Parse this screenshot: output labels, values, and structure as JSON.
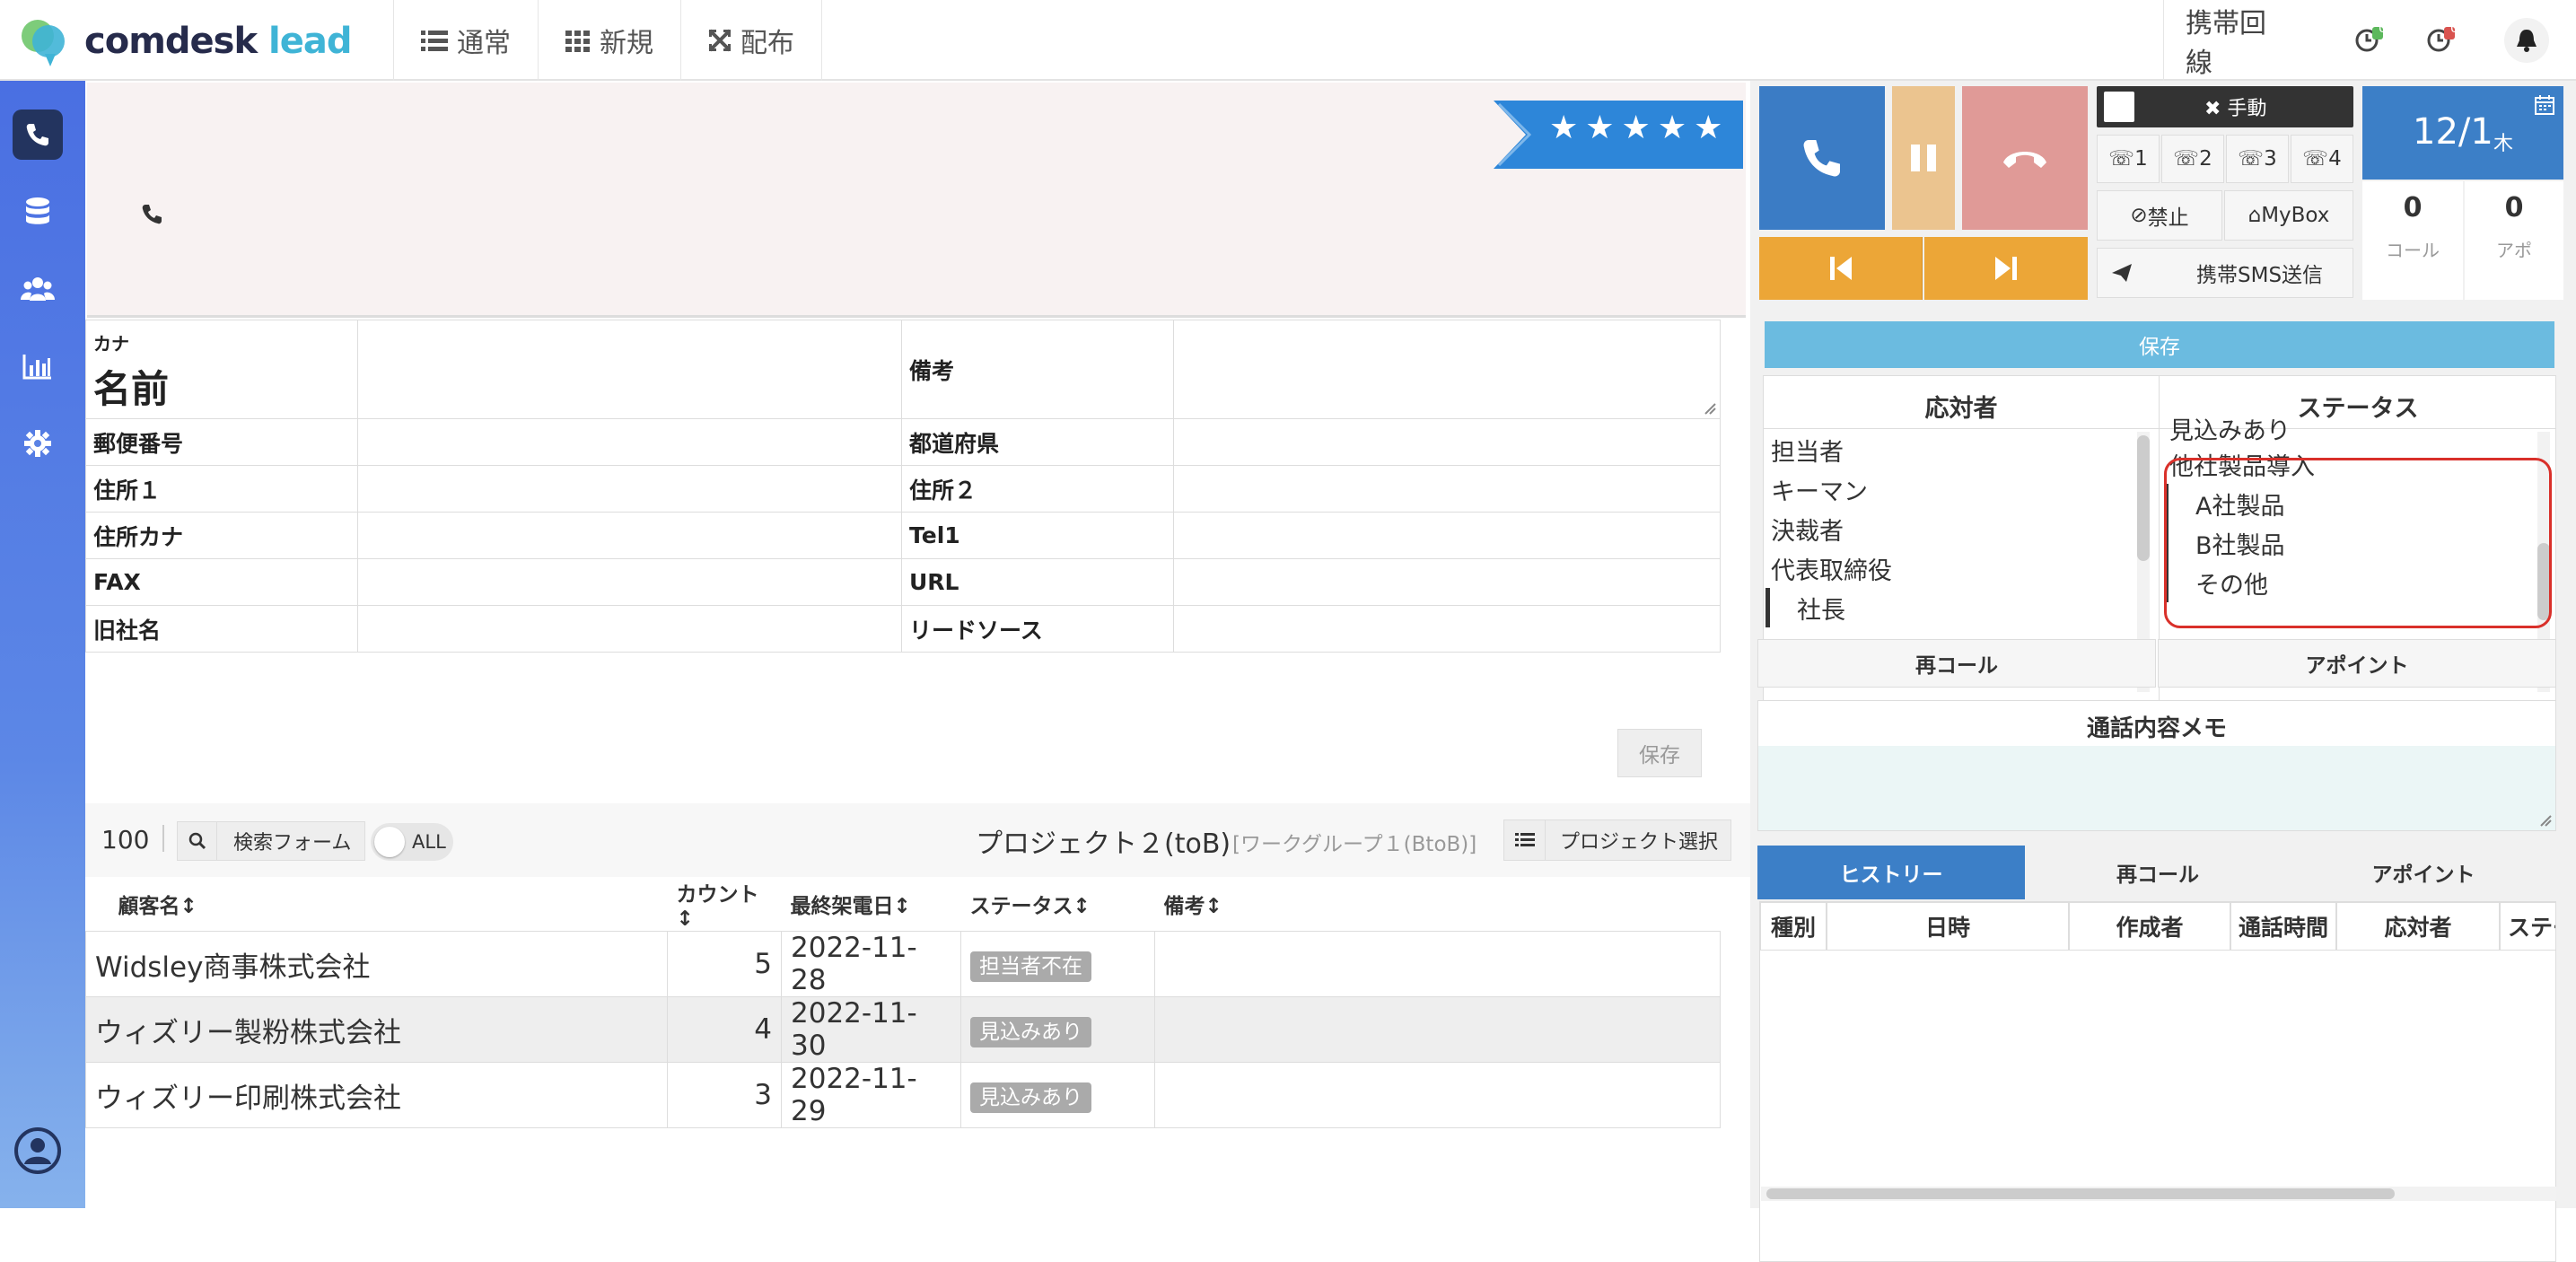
{
  "app": {
    "logo_main": "comdesk",
    "logo_accent": "lead"
  },
  "nav": [
    {
      "label": "通常",
      "icon": "list-icon"
    },
    {
      "label": "新規",
      "icon": "grid-icon"
    },
    {
      "label": "配布",
      "icon": "expand-icon"
    }
  ],
  "topright": {
    "mobile_line": "携帯回線",
    "badge1": "0",
    "badge2": "0"
  },
  "sidebar": [
    "phone-icon",
    "database-icon",
    "users-icon",
    "chart-icon",
    "gear-icon",
    "user-circle-icon"
  ],
  "rating": {
    "stars": "★★★★★",
    "value": 5
  },
  "customer": {
    "kana_label": "カナ",
    "name_label": "名前",
    "remarks_label": "備考",
    "zip_label": "郵便番号",
    "pref_label": "都道府県",
    "addr1_label": "住所１",
    "addr2_label": "住所２",
    "addrkana_label": "住所カナ",
    "tel1_label": "Tel1",
    "fax_label": "FAX",
    "url_label": "URL",
    "oldname_label": "旧社名",
    "leadsource_label": "リードソース",
    "save_label": "保存"
  },
  "listbar": {
    "count": "100",
    "search_label": "検索フォーム",
    "all_label": "ALL",
    "project_name": "プロジェクト２(toB)",
    "workgroup": "[ワークグループ１(BtoB)]",
    "project_select_label": "プロジェクト選択"
  },
  "table": {
    "headers": [
      "顧客名↕",
      "カウント↕",
      "最終架電日↕",
      "ステータス↕",
      "備考↕"
    ],
    "rows": [
      {
        "name": "Widsley商事株式会社",
        "count": "5",
        "date": "2022-11-28",
        "status": "担当者不在",
        "note": ""
      },
      {
        "name": "ウィズリー製粉株式会社",
        "count": "4",
        "date": "2022-11-30",
        "status": "見込みあり",
        "note": ""
      },
      {
        "name": "ウィズリー印刷株式会社",
        "count": "3",
        "date": "2022-11-29",
        "status": "見込みあり",
        "note": ""
      }
    ]
  },
  "phone": {
    "manual_label": "手動",
    "lines": [
      "1",
      "2",
      "3",
      "4"
    ],
    "ban_label": "禁止",
    "mybox_label": "MyBox",
    "sms_label": "携帯SMS送信",
    "date_main": "12/1",
    "date_day": "木",
    "calls_value": "0",
    "calls_label": "コール",
    "apo_value": "0",
    "apo_label": "アポ"
  },
  "result": {
    "save_label": "保存",
    "respondent_title": "応対者",
    "status_title": "ステータス",
    "respondents": [
      {
        "label": "担当者",
        "indent": false
      },
      {
        "label": "キーマン",
        "indent": false
      },
      {
        "label": "決裁者",
        "indent": false
      },
      {
        "label": "代表取締役",
        "indent": false
      },
      {
        "label": "社長",
        "indent": true
      }
    ],
    "statuses": [
      {
        "label": "見込みあり",
        "indent": false
      },
      {
        "label": "他社製品導入",
        "indent": false
      },
      {
        "label": "A社製品",
        "indent": true
      },
      {
        "label": "B社製品",
        "indent": true
      },
      {
        "label": "その他",
        "indent": true
      }
    ],
    "recall_label": "再コール",
    "appoint_label": "アポイント",
    "memo_title": "通話内容メモ"
  },
  "history": {
    "tabs": [
      "ヒストリー",
      "再コール",
      "アポイント"
    ],
    "headers": [
      "種別",
      "日時",
      "作成者",
      "通話時間",
      "応対者",
      "ステー"
    ]
  },
  "colors": {
    "accent": "#3c7fc7",
    "phone_green": "#3b7cc5",
    "hold": "#ebc48f",
    "hangup": "#e09a97",
    "orange": "#eca637",
    "highlight": "#d9302a"
  }
}
